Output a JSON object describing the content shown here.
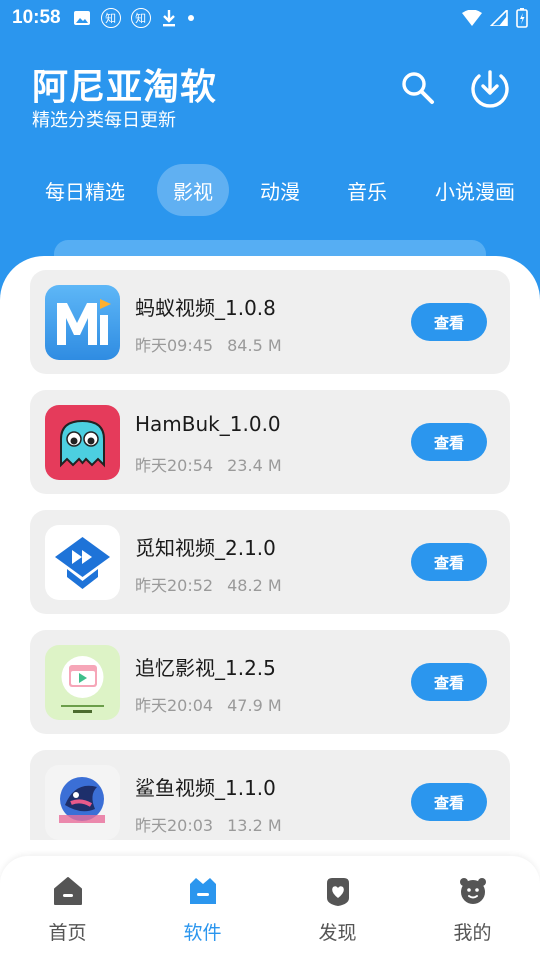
{
  "status_bar": {
    "time": "10:58",
    "left_icons": [
      "image-icon",
      "zhihu-icon",
      "zhihu-icon",
      "download-icon",
      "dot-icon"
    ],
    "zhihu_glyph": "知",
    "right_icons": [
      "wifi-icon",
      "signal-icon",
      "battery-icon"
    ]
  },
  "header": {
    "title": "阿尼亚淘软",
    "subtitle": "精选分类每日更新",
    "actions": [
      "search-icon",
      "download-icon"
    ]
  },
  "tabs": [
    {
      "label": "每日精选",
      "active": false
    },
    {
      "label": "影视",
      "active": true
    },
    {
      "label": "动漫",
      "active": false
    },
    {
      "label": "音乐",
      "active": false
    },
    {
      "label": "小说漫画",
      "active": false
    }
  ],
  "apps": [
    {
      "name": "蚂蚁视频_1.0.8",
      "time": "昨天09:45",
      "size": "84.5 M",
      "button": "查看",
      "icon": "mayi-video-logo"
    },
    {
      "name": "HamBuk_1.0.0",
      "time": "昨天20:54",
      "size": "23.4 M",
      "button": "查看",
      "icon": "pacman-ghost-logo"
    },
    {
      "name": "觅知视频_2.1.0",
      "time": "昨天20:52",
      "size": "48.2 M",
      "button": "查看",
      "icon": "mizhi-video-logo"
    },
    {
      "name": "追忆影视_1.2.5",
      "time": "昨天20:04",
      "size": "47.9 M",
      "button": "查看",
      "icon": "zhuiyi-logo"
    },
    {
      "name": "鲨鱼视频_1.1.0",
      "time": "昨天20:03",
      "size": "13.2 M",
      "button": "查看",
      "icon": "shark-video-logo"
    }
  ],
  "bottom_nav": [
    {
      "label": "首页",
      "icon": "home-icon",
      "active": false
    },
    {
      "label": "软件",
      "icon": "software-icon",
      "active": true
    },
    {
      "label": "发现",
      "icon": "discover-icon",
      "active": false
    },
    {
      "label": "我的",
      "icon": "profile-icon",
      "active": false
    }
  ],
  "colors": {
    "primary": "#2B96EE",
    "card_bg": "#EFEFEF",
    "meta_text": "#9A9A9A"
  }
}
